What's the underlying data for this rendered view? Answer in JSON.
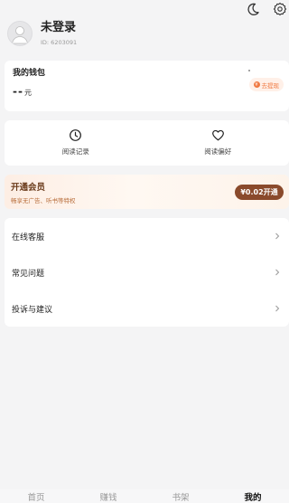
{
  "header": {
    "moon_icon": "moon-icon",
    "gear_icon": "gear-icon"
  },
  "profile": {
    "name": "未登录",
    "id": "ID: 6203091",
    "avatar_icon": "user-avatar-icon"
  },
  "wallet": {
    "title": "我的钱包",
    "amount": "--",
    "unit": "元",
    "withdraw_label": "去提现",
    "withdraw_icon": "yuan-icon"
  },
  "quick": [
    {
      "label": "阅读记录",
      "icon": "clock-icon"
    },
    {
      "label": "阅读偏好",
      "icon": "heart-icon"
    }
  ],
  "vip": {
    "title": "开通会员",
    "subtitle": "畅享无广告、听书等特权",
    "button": "¥0.02开通"
  },
  "menu": [
    {
      "label": "在线客服"
    },
    {
      "label": "常见问题"
    },
    {
      "label": "投诉与建议"
    }
  ],
  "tabs": [
    {
      "label": "首页",
      "active": false
    },
    {
      "label": "赚钱",
      "active": false
    },
    {
      "label": "书架",
      "active": false
    },
    {
      "label": "我的",
      "active": true
    }
  ],
  "colors": {
    "accent": "#f07840",
    "vip_button": "#8a4a2c",
    "background": "#f4f4f5"
  }
}
